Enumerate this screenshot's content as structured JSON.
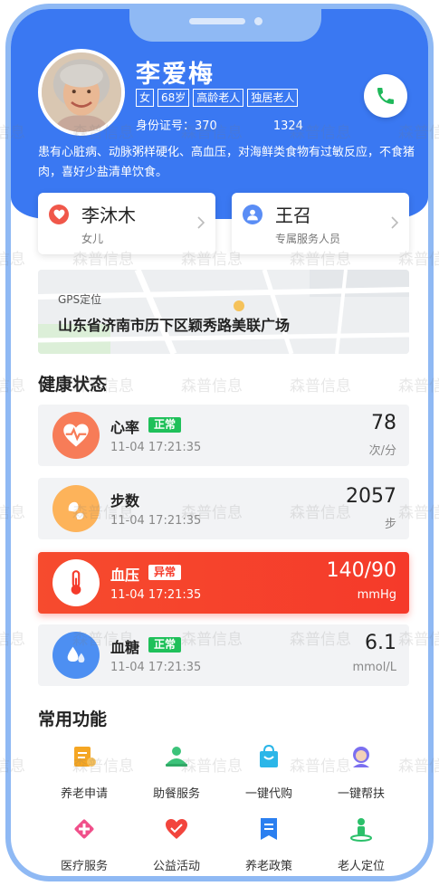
{
  "profile": {
    "name": "李爱梅",
    "tags": [
      "女",
      "68岁",
      "高龄老人",
      "独居老人"
    ],
    "id_label": "身份证号：370",
    "id_tail": "1324",
    "note": "患有心脏病、动脉粥样硬化、高血压，对海鲜类食物有过敏反应，不食猪肉，喜好少盐清单饮食。"
  },
  "contacts": [
    {
      "name": "李沐木",
      "role": "女儿",
      "icon": "heart-icon",
      "color": "#f0574a"
    },
    {
      "name": "王召",
      "role": "专属服务人员",
      "icon": "user-icon",
      "color": "#5a8df5"
    }
  ],
  "location": {
    "label": "GPS定位",
    "address": "山东省济南市历下区颖秀路美联广场"
  },
  "health": {
    "title": "健康状态",
    "items": [
      {
        "name": "心率",
        "badge": "正常",
        "time": "11-04  17:21:35",
        "value": "78",
        "unit": "次/分",
        "icon": "heartbeat-icon",
        "icon_color": "#f77c58",
        "badge_color": "#1fc05a",
        "alert": false
      },
      {
        "name": "步数",
        "badge": "",
        "time": "11-04  17:21:35",
        "value": "2057",
        "unit": "步",
        "icon": "steps-icon",
        "icon_color": "#fdb35a",
        "badge_color": "",
        "alert": false
      },
      {
        "name": "血压",
        "badge": "异常",
        "time": "11-04  17:21:35",
        "value": "140/90",
        "unit": "mmHg",
        "icon": "thermometer-icon",
        "icon_color": "#ffffff",
        "badge_color": "#ffffff",
        "alert": true
      },
      {
        "name": "血糖",
        "badge": "正常",
        "time": "11-04  17:21:35",
        "value": "6.1",
        "unit": "mmol/L",
        "icon": "drops-icon",
        "icon_color": "#4d8ff2",
        "badge_color": "#1fc05a",
        "alert": false
      }
    ]
  },
  "functions": {
    "title": "常用功能",
    "items": [
      {
        "label": "养老申请",
        "icon": "application-icon",
        "color": "#f5a623"
      },
      {
        "label": "助餐服务",
        "icon": "meal-service-icon",
        "color": "#3cc37a"
      },
      {
        "label": "一键代购",
        "icon": "shopping-bag-icon",
        "color": "#2bb6e8"
      },
      {
        "label": "一键帮扶",
        "icon": "helper-icon",
        "color": "#7b6ff0"
      },
      {
        "label": "医疗服务",
        "icon": "medical-icon",
        "color": "#f04f8a"
      },
      {
        "label": "公益活动",
        "icon": "charity-icon",
        "color": "#f2453d"
      },
      {
        "label": "养老政策",
        "icon": "policy-icon",
        "color": "#2b7ff0"
      },
      {
        "label": "老人定位",
        "icon": "location-person-icon",
        "color": "#2bc06a"
      }
    ]
  },
  "watermark_text": "森普信息",
  "colors": {
    "primary": "#3a78f2",
    "alert": "#f53a2a",
    "normal_badge": "#1fc05a",
    "frame": "#8fb9f4"
  }
}
